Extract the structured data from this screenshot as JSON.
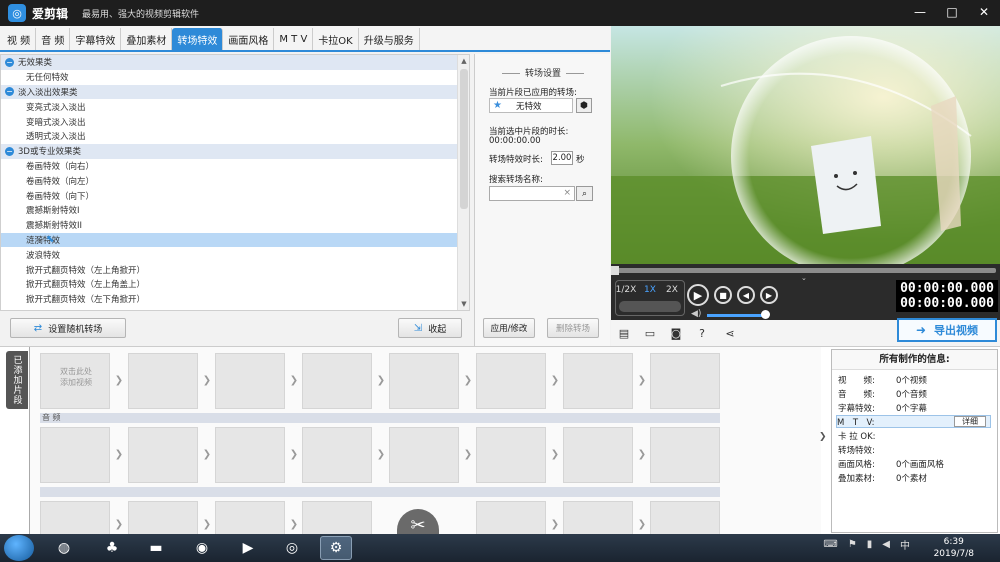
{
  "window": {
    "app_name": "爱剪辑",
    "slogan": "最易用、强大的视频剪辑软件",
    "controls": [
      "—",
      "□",
      "✕"
    ]
  },
  "tabs": [
    {
      "label": "视 频",
      "active": false
    },
    {
      "label": "音 频",
      "active": false
    },
    {
      "label": "字幕特效",
      "active": false
    },
    {
      "label": "叠加素材",
      "active": false
    },
    {
      "label": "转场特效",
      "active": true
    },
    {
      "label": "画面风格",
      "active": false
    },
    {
      "label": "M T V",
      "active": false
    },
    {
      "label": "卡拉OK",
      "active": false
    },
    {
      "label": "升级与服务",
      "active": false
    }
  ],
  "effects": {
    "groups": [
      {
        "name": "无效果类",
        "items": [
          "无任何特效"
        ]
      },
      {
        "name": "淡入淡出效果类",
        "items": [
          "变亮式淡入淡出",
          "变暗式淡入淡出",
          "透明式淡入淡出"
        ]
      },
      {
        "name": "3D或专业效果类",
        "items": [
          "卷画特效（向右）",
          "卷画特效（向左）",
          "卷画特效（向下）",
          "震撼斯射特效I",
          "震撼斯射特效II",
          "涟漪特效",
          "波浪特效",
          "掀开式翻页特效（左上角掀开）",
          "掀开式翻页特效（左上角盖上）",
          "掀开式翻页特效（左下角掀开）"
        ]
      }
    ],
    "selected_item": "涟漪特效"
  },
  "left_buttons": {
    "random": "设置随机转场",
    "collect": "收起"
  },
  "settings": {
    "heading": "转场设置",
    "applied_label": "当前片段已应用的转场:",
    "applied_value": "无特效",
    "duration_label": "当前选中片段的时长:",
    "duration_value": "00:00:00.00",
    "effect_duration_label": "转场特效时长:",
    "effect_duration_value": "2.00",
    "effect_duration_unit": "秒",
    "search_label": "搜索转场名称:",
    "search_clear": "×",
    "apply_button": "应用/修改",
    "delete_button": "删除转场"
  },
  "player": {
    "speeds": [
      "1/2X",
      "1X",
      "2X"
    ],
    "active_speed": "1X",
    "time_current": "00:00:00.000",
    "time_total": "00:00:00.000",
    "volume_percent": 90,
    "export_label": "导出视频"
  },
  "storyboard": {
    "side_tab": "已添加片段",
    "add_hint_line1": "双击此处",
    "add_hint_line2": "添加视频",
    "audio_label": "音 频"
  },
  "info": {
    "title": "所有制作的信息:",
    "rows": [
      {
        "k": "视　　频:",
        "v": "0个视频"
      },
      {
        "k": "音　　频:",
        "v": "0个音频"
      },
      {
        "k": "字幕特效:",
        "v": "0个字幕"
      },
      {
        "k": "M　T　V:",
        "v": ""
      },
      {
        "k": "卡 拉 OK:",
        "v": ""
      },
      {
        "k": "转场特效:",
        "v": ""
      },
      {
        "k": "画面风格:",
        "v": "0个画面风格"
      },
      {
        "k": "叠加素材:",
        "v": "0个素材"
      }
    ],
    "detail_button": "详细"
  },
  "taskbar": {
    "time": "6:39",
    "date": "2019/7/8"
  },
  "colors": {
    "accent": "#2e8ad8",
    "selected_row": "#b9d8f6"
  }
}
